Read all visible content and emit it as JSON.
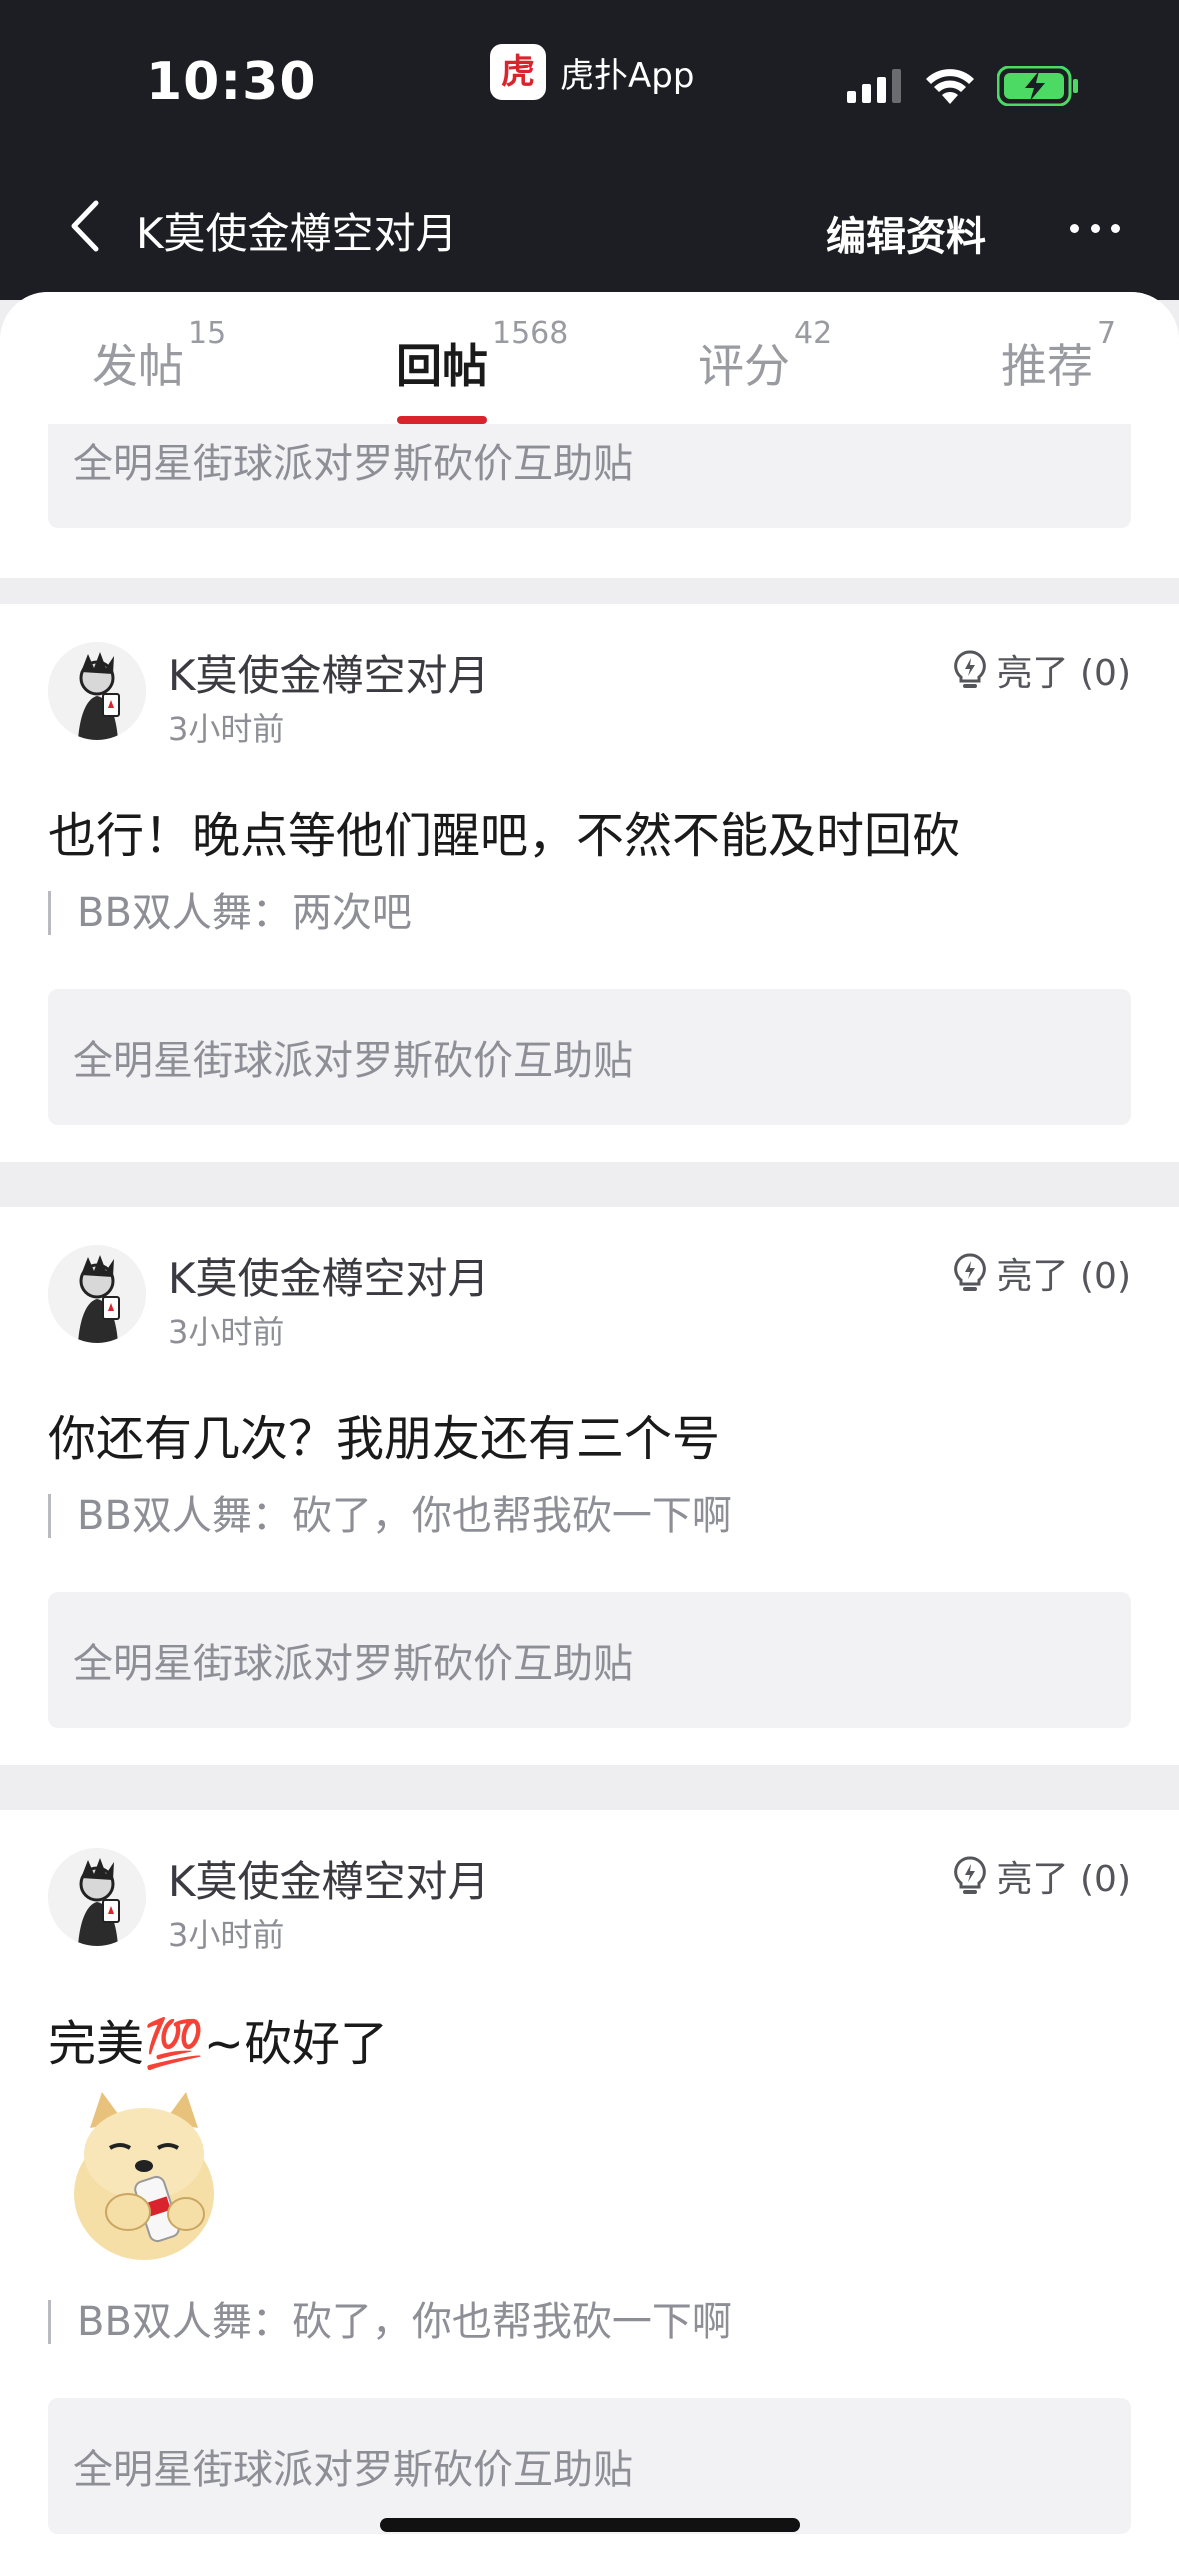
{
  "status_bar": {
    "time": "10:30",
    "app_name": "虎扑App",
    "app_logo_char": "虎扑"
  },
  "nav": {
    "title": "K莫使金樽空对月",
    "edit_label": "编辑资料",
    "more_icon": "more-icon"
  },
  "tabs": [
    {
      "label": "发帖",
      "count": "15"
    },
    {
      "label": "回帖",
      "count": "1568"
    },
    {
      "label": "评分",
      "count": "42"
    },
    {
      "label": "推荐",
      "count": "7"
    }
  ],
  "top_quote": "全明星街球派对罗斯砍价互助贴",
  "posts": [
    {
      "author": "K莫使金樽空对月",
      "time": "3小时前",
      "like": "亮了 (0)",
      "content": "也行！晚点等他们醒吧，不然不能及时回砍",
      "reply_quote": "BB双人舞：两次吧",
      "thread": "全明星街球派对罗斯砍价互助贴"
    },
    {
      "author": "K莫使金樽空对月",
      "time": "3小时前",
      "like": "亮了 (0)",
      "content": "你还有几次？我朋友还有三个号",
      "reply_quote": "BB双人舞：砍了，你也帮我砍一下啊",
      "thread": "全明星街球派对罗斯砍价互助贴"
    },
    {
      "author": "K莫使金樽空对月",
      "time": "3小时前",
      "like": "亮了 (0)",
      "content": "完美💯~砍好了",
      "reply_quote": "BB双人舞：砍了，你也帮我砍一下啊",
      "thread": "全明星街球派对罗斯砍价互助贴"
    }
  ],
  "colors": {
    "header_bg": "#1d1e23",
    "accent": "#d9232d",
    "battery": "#4cd964"
  }
}
